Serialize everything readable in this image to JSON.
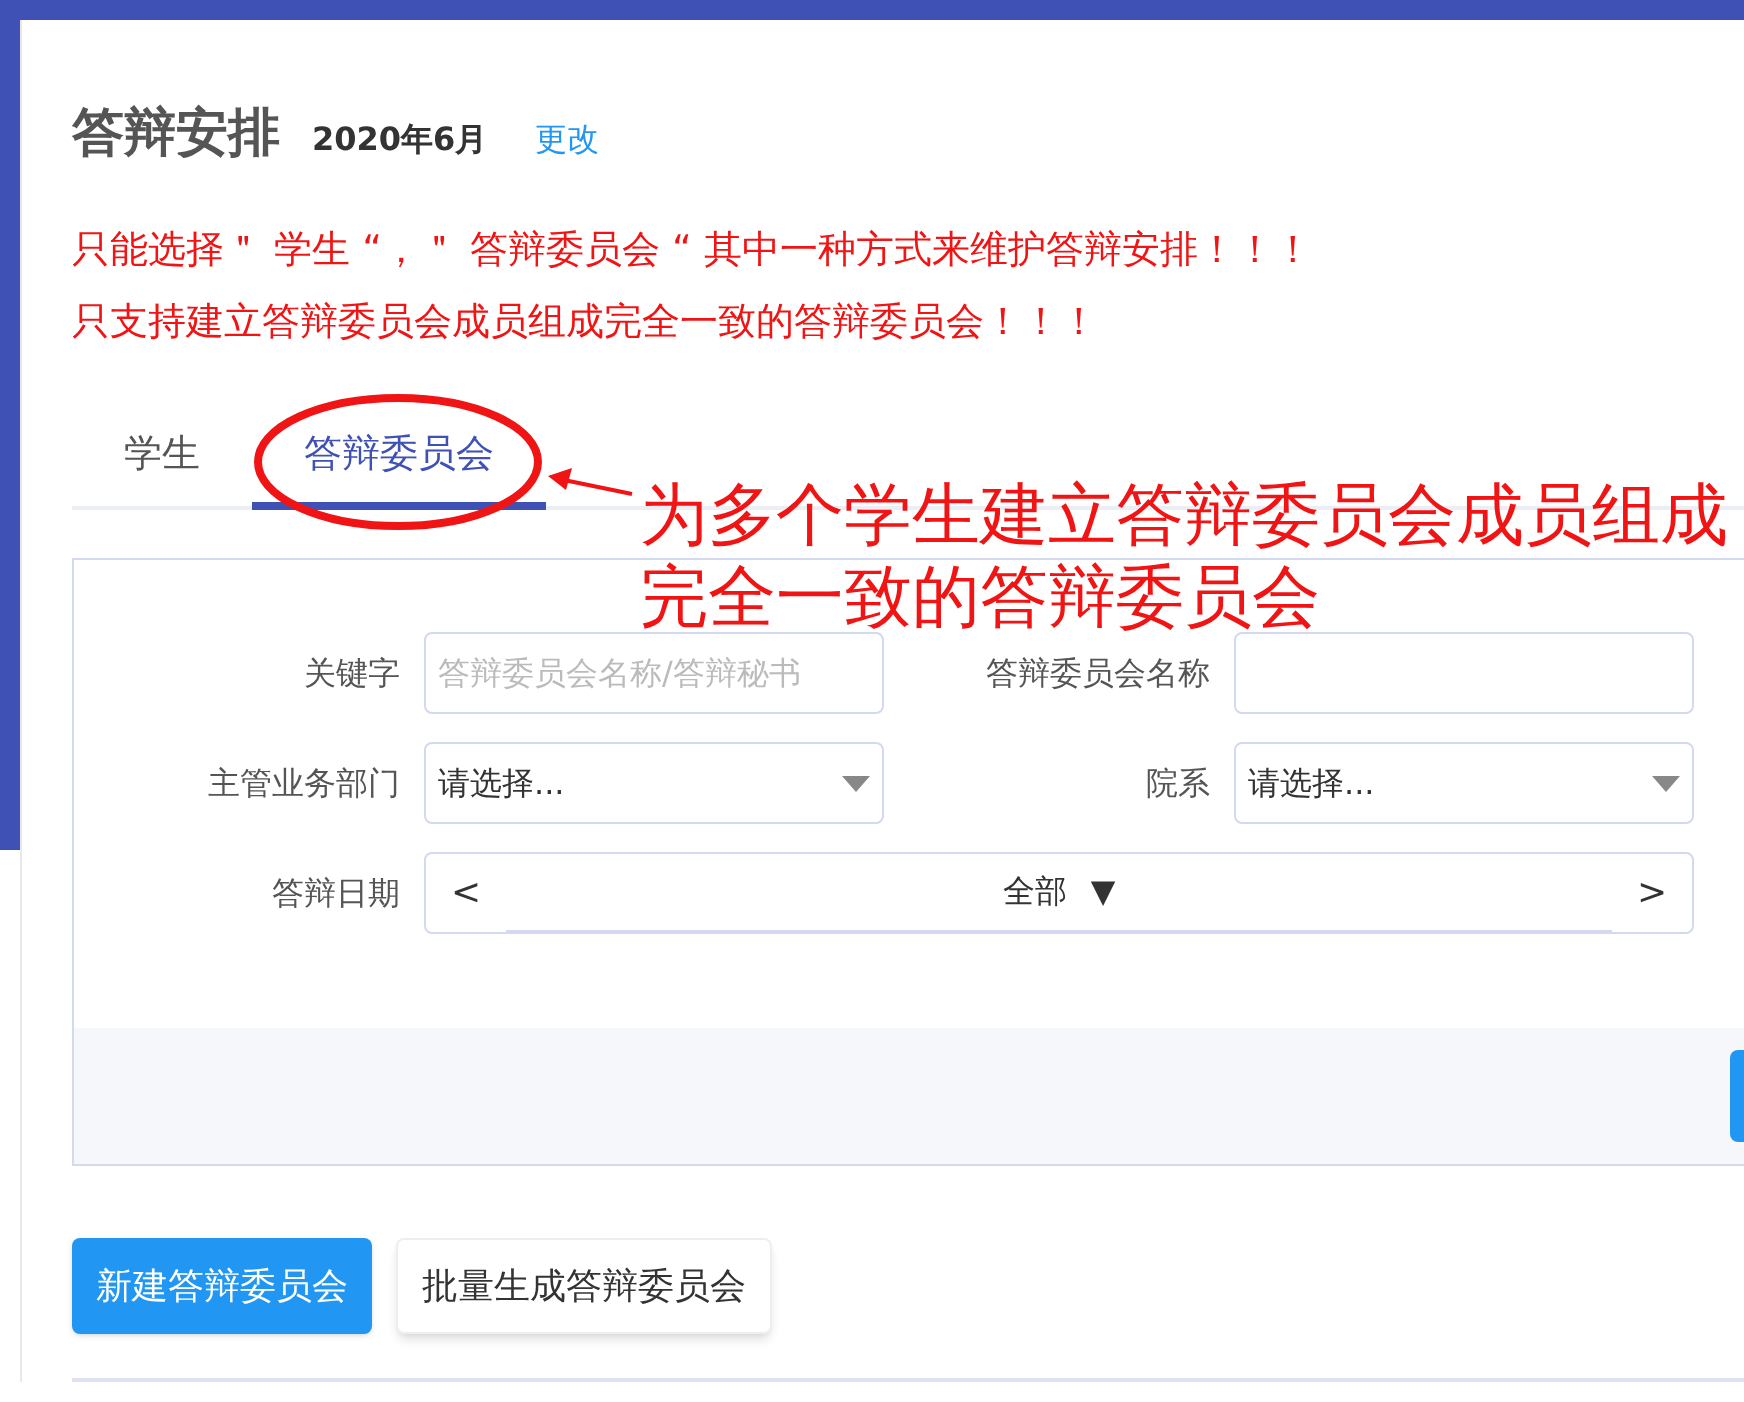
{
  "header": {
    "title": "答辩安排",
    "period": "2020年6月",
    "change_link": "更改"
  },
  "warnings": [
    "只能选择＂ 学生 “，＂ 答辩委员会 “ 其中一种方式来维护答辩安排！！！",
    "只支持建立答辩委员会成员组成完全一致的答辩委员会！！！"
  ],
  "tabs": [
    {
      "label": "学生",
      "selected": false
    },
    {
      "label": "答辩委员会",
      "selected": true
    }
  ],
  "annotation": {
    "text": "为多个学生建立答辩委员会成员组成完全一致的答辩委员会"
  },
  "filters": [
    [
      {
        "kind": "text",
        "label": "关键字",
        "placeholder": "答辩委员会名称/答辩秘书"
      },
      {
        "kind": "text",
        "label": "答辩委员会名称"
      }
    ],
    [
      {
        "kind": "select",
        "label": "主管业务部门",
        "value": "请选择..."
      },
      {
        "kind": "select",
        "label": "院系",
        "value": "请选择..."
      }
    ],
    [
      {
        "kind": "date_nav",
        "label": "答辩日期",
        "prev": "<",
        "value": "全部",
        "caret": "▼",
        "next": ">"
      }
    ]
  ],
  "buttons": [
    {
      "label": "新建答辩委员会",
      "kind": "primary"
    },
    {
      "label": "批量生成答辩委员会",
      "kind": "default"
    }
  ]
}
